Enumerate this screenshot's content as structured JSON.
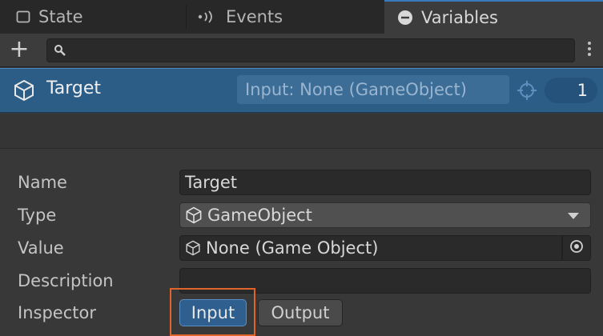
{
  "tabs": [
    {
      "label": "State",
      "icon": "square-icon",
      "active": false
    },
    {
      "label": "Events",
      "icon": "broadcast-icon",
      "active": false
    },
    {
      "label": "Variables",
      "icon": "minus-circle-icon",
      "active": true
    }
  ],
  "toolbar": {
    "add_icon": "plus-icon",
    "search_icon": "magnifier-icon",
    "search_value": "",
    "menu_icon": "kebab-icon"
  },
  "selected_variable": {
    "name": "Target",
    "icon": "cube-icon",
    "input_value": "Input: None (GameObject)",
    "target_icon": "crosshair-icon",
    "usage_count": "1"
  },
  "properties": {
    "name": {
      "label": "Name",
      "value": "Target"
    },
    "type": {
      "label": "Type",
      "value": "GameObject"
    },
    "value": {
      "label": "Value",
      "value": "None (Game Object)"
    },
    "description": {
      "label": "Description",
      "value": ""
    },
    "inspector": {
      "label": "Inspector",
      "input_label": "Input",
      "output_label": "Output"
    }
  },
  "colors": {
    "accent": "#3a79bb",
    "selection": "#2c5d87",
    "highlight": "#e0652a"
  }
}
